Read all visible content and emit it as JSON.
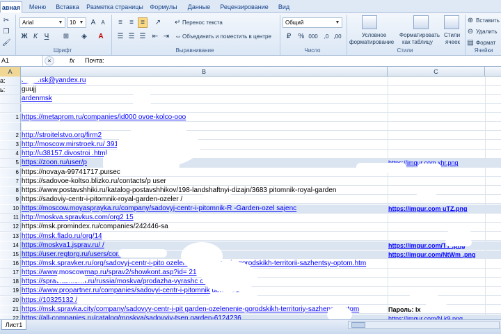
{
  "tabs": [
    "авная",
    "Меню",
    "Вставка",
    "Разметка страницы",
    "Формулы",
    "Данные",
    "Рецензирование",
    "Вид"
  ],
  "ribbon": {
    "font_name": "Arial",
    "font_size": "10",
    "wrap_text": "Перенос текста",
    "merge_center": "Объединить и поместить в центре",
    "number_format": "Общий",
    "cond_format_1": "Условное",
    "cond_format_2": "форматирование",
    "format_table_1": "Форматировать",
    "format_table_2": "как таблицу",
    "cell_styles_1": "Стили",
    "cell_styles_2": "ячеек",
    "insert": "Вставить",
    "delete": "Удалить",
    "format": "Формат",
    "groups": {
      "font": "Шрифт",
      "alignment": "Выравнивание",
      "number": "Число",
      "styles": "Стили",
      "cells": "Ячейки"
    }
  },
  "formula_bar": {
    "name_box": "A1",
    "fx": "fx",
    "value": "Почта:"
  },
  "columns": {
    "a": "A",
    "b": "B",
    "c": "C"
  },
  "rows": [
    {
      "num": "",
      "a": "a:",
      "b": "rdenmsk@yandex.ru",
      "c": "",
      "b_link": true,
      "c_link": false,
      "c_bold": false,
      "hl": false
    },
    {
      "num": "",
      "a": "ь:",
      "b": "guujj",
      "c": "",
      "b_link": false,
      "c_link": false,
      "c_bold": false,
      "hl": false
    },
    {
      "num": "",
      "a": "",
      "b": "ardenmsk",
      "c": "",
      "b_link": true,
      "c_link": false,
      "c_bold": false,
      "hl": false
    },
    {
      "num": "",
      "a": "",
      "b": "",
      "c": "",
      "b_link": false,
      "c_link": false,
      "c_bold": false,
      "hl": false
    },
    {
      "num": "1",
      "a": "",
      "b": "https://metaprom.ru/companies/id000                    ovoe-kolco-ooo",
      "c": "",
      "b_link": true,
      "c_link": false,
      "c_bold": false,
      "hl": false
    },
    {
      "num": "",
      "a": "",
      "b": "",
      "c": "",
      "b_link": false,
      "c_link": false,
      "c_bold": false,
      "hl": false
    },
    {
      "num": "2",
      "a": "",
      "b": "http://stroitelstvo.org/firm2",
      "c": "",
      "b_link": true,
      "c_link": false,
      "c_bold": false,
      "hl": false
    },
    {
      "num": "3",
      "a": "",
      "b": "http://moscow.mirstroek.ru/                 391/",
      "c": "",
      "b_link": true,
      "c_link": false,
      "c_bold": false,
      "hl": false
    },
    {
      "num": "4",
      "a": "",
      "b": "http://u38157.divostroi                 .html",
      "c": "",
      "b_link": true,
      "c_link": false,
      "c_bold": false,
      "hl": false
    },
    {
      "num": "5",
      "a": "",
      "b": "https://zoon.ru/user/p",
      "c": "https://imgur.com          xhr.png",
      "b_link": true,
      "c_link": true,
      "c_bold": false,
      "hl": true
    },
    {
      "num": "6",
      "a": "",
      "b": "https://novaya-99741717.pulsec",
      "c": "",
      "b_link": false,
      "c_link": false,
      "c_bold": false,
      "hl": false
    },
    {
      "num": "7",
      "a": "",
      "b": "https://sadovoe-koltso.blizko.ru/contacts/p           user",
      "c": "",
      "b_link": false,
      "c_link": false,
      "c_bold": false,
      "hl": false
    },
    {
      "num": "8",
      "a": "",
      "b": "https://www.postavshhiki.ru/katalog-postavshhikov/198-landshaftnyi-dizajn/3683               pitomnik-royal-garden",
      "c": "",
      "b_link": false,
      "c_link": false,
      "c_bold": false,
      "hl": false
    },
    {
      "num": "9",
      "a": "",
      "b": "https://sadoviy-centr-i-pitomnik-royal-garden-ozeler                    /",
      "c": "",
      "b_link": false,
      "c_link": false,
      "c_bold": false,
      "hl": false
    },
    {
      "num": "10",
      "a": "",
      "b": "https://moscow.moyasprayka.ru/company/sadovyj-centr-i-pitomnik-R     -Garden-ozel                         sajenc",
      "c": "https://imgur.com       uTZ.png",
      "b_link": true,
      "c_link": true,
      "c_bold": true,
      "hl": true
    },
    {
      "num": "11",
      "a": "",
      "b": "http://moskva.spravkus.com/org2          15",
      "c": "",
      "b_link": true,
      "c_link": false,
      "c_bold": false,
      "hl": false
    },
    {
      "num": "12",
      "a": "",
      "b": "https://msk.promindex.ru/companies/242446-sa",
      "c": "",
      "b_link": false,
      "c_link": false,
      "c_bold": false,
      "hl": false
    },
    {
      "num": "13",
      "a": "",
      "b": "https://msk.flado.ru/org/14",
      "c": "",
      "b_link": true,
      "c_link": false,
      "c_bold": false,
      "hl": false
    },
    {
      "num": "14",
      "a": "",
      "b": "https://moskva1.jsprav.ru/           /",
      "c": "https://imgur.com/TT         .png",
      "b_link": true,
      "c_link": true,
      "c_bold": true,
      "hl": true
    },
    {
      "num": "15",
      "a": "",
      "b": "https://user.regtorg.ru/users/comp/?ok=           1",
      "c": "https://imgur.com/NtWm       .png",
      "b_link": true,
      "c_link": true,
      "c_bold": true,
      "hl": true
    },
    {
      "num": "16",
      "a": "",
      "b": "https://msk.spravker.ru/org/sadovyj-centr-i-pito              ozelenenie-ozelenenie-gorodskikh-territorii-sazhentsy-optom.htm",
      "c": "",
      "b_link": true,
      "c_link": false,
      "c_bold": false,
      "hl": false
    },
    {
      "num": "17",
      "a": "",
      "b": "https://www.moscowmap.ru/sprav2/showkont.asp?id=            21",
      "c": "",
      "b_link": true,
      "c_link": false,
      "c_bold": false,
      "hl": false
    },
    {
      "num": "18",
      "a": "",
      "b": "https://spravkainform.ru/russia/moskva/prodazha-vyrashc              cvetov/             /",
      "c": "",
      "b_link": true,
      "c_link": false,
      "c_bold": false,
      "hl": false
    },
    {
      "num": "19",
      "a": "",
      "b": "https://www.propartner.ru/companies/sadovyi-centr-i-pitomnik              den-       851",
      "c": "",
      "b_link": true,
      "c_link": false,
      "c_bold": false,
      "hl": false
    },
    {
      "num": "20",
      "a": "",
      "b": "https://10325132           /",
      "c": "",
      "b_link": true,
      "c_link": false,
      "c_bold": false,
      "hl": false
    },
    {
      "num": "21",
      "a": "",
      "b": "https://msk.spravka.city/company/sadovyy-centr-i-pit              garden-ozelenenie-gorodskikh-territoriy-sazhency-optom",
      "c": "Пароль:           lx",
      "b_link": true,
      "c_link": false,
      "c_bold": true,
      "hl": false
    },
    {
      "num": "22",
      "a": "",
      "b": "https://all-companies.ru/catalog/moskva/sadovyiy-tsen           garden-6124236",
      "c": "https://imgur.com/N         k9.png",
      "b_link": true,
      "c_link": true,
      "c_bold": false,
      "hl": true
    },
    {
      "num": "23",
      "a": "",
      "b": "https://orghost.ru/moskva/com-sadovyj-tsentr-i-pitomnik-ro          -ozelenenie-gorodskikh-territoriy-sazhentsy-optom",
      "c": "",
      "b_link": true,
      "c_link": false,
      "c_bold": false,
      "hl": false
    }
  ],
  "status": {
    "sheet": "Лист1"
  }
}
